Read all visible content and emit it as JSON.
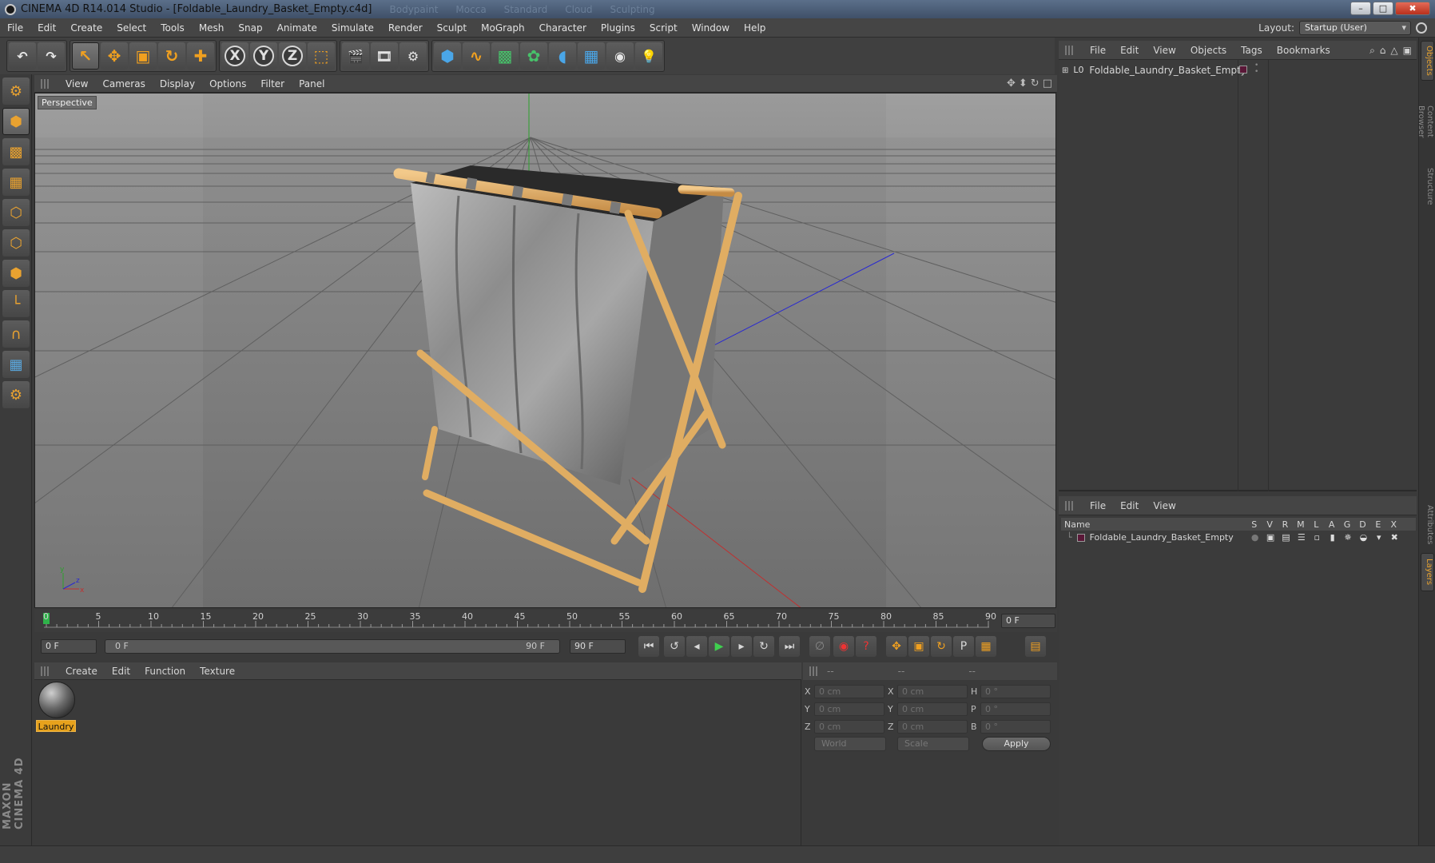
{
  "window": {
    "title": "CINEMA 4D R14.014 Studio - [Foldable_Laundry_Basket_Empty.c4d]",
    "ghost_menus": [
      "Bodypaint",
      "Mocca",
      "Standard",
      "Cloud",
      "Sculpting"
    ],
    "minimize": "–",
    "maximize": "□",
    "close": "✖"
  },
  "menubar": {
    "items": [
      "File",
      "Edit",
      "Create",
      "Select",
      "Tools",
      "Mesh",
      "Snap",
      "Animate",
      "Simulate",
      "Render",
      "Sculpt",
      "MoGraph",
      "Character",
      "Plugins",
      "Script",
      "Window",
      "Help"
    ],
    "layout_label": "Layout:",
    "layout_value": "Startup (User)"
  },
  "toolbar": {
    "undo": "↶",
    "redo": "↷",
    "x_axis": "X",
    "y_axis": "Y",
    "z_axis": "Z"
  },
  "viewport": {
    "menu": [
      "View",
      "Cameras",
      "Display",
      "Options",
      "Filter",
      "Panel"
    ],
    "label": "Perspective",
    "axis_x": "x",
    "axis_y": "y",
    "axis_z": "z"
  },
  "timeline": {
    "ticks": [
      "0",
      "5",
      "10",
      "15",
      "20",
      "25",
      "30",
      "35",
      "40",
      "45",
      "50",
      "55",
      "60",
      "65",
      "70",
      "75",
      "80",
      "85",
      "90"
    ],
    "current_frame": "0 F",
    "start_field": "0 F",
    "slider_start": "0 F",
    "slider_end": "90 F",
    "end_field": "90 F"
  },
  "material_manager": {
    "menu": [
      "Create",
      "Edit",
      "Function",
      "Texture"
    ],
    "materials": [
      {
        "name": "Laundry"
      }
    ]
  },
  "coordinates": {
    "head": [
      "--",
      "--",
      "--"
    ],
    "rows": [
      {
        "a": "X",
        "v1": "0 cm",
        "b": "X",
        "v2": "0 cm",
        "c": "H",
        "v3": "0 °"
      },
      {
        "a": "Y",
        "v1": "0 cm",
        "b": "Y",
        "v2": "0 cm",
        "c": "P",
        "v3": "0 °"
      },
      {
        "a": "Z",
        "v1": "0 cm",
        "b": "Z",
        "v2": "0 cm",
        "c": "B",
        "v3": "0 °"
      }
    ],
    "space": "World",
    "mode": "Scale",
    "apply": "Apply"
  },
  "object_manager": {
    "menu": [
      "File",
      "Edit",
      "View",
      "Objects",
      "Tags",
      "Bookmarks"
    ],
    "objects": [
      {
        "name": "Foldable_Laundry_Basket_Empty"
      }
    ]
  },
  "layer_manager": {
    "menu": [
      "File",
      "Edit",
      "View"
    ],
    "columns": {
      "name": "Name",
      "flags": [
        "S",
        "V",
        "R",
        "M",
        "L",
        "A",
        "G",
        "D",
        "E",
        "X"
      ]
    },
    "layers": [
      {
        "name": "Foldable_Laundry_Basket_Empty"
      }
    ]
  },
  "side_tabs": [
    "Objects",
    "Content Browser",
    "Structure",
    "Attributes",
    "Layers"
  ],
  "branding": "MAXON CINEMA 4D",
  "colors": {
    "accent": "#e7a21c",
    "active_frame": "#2fb34a"
  }
}
